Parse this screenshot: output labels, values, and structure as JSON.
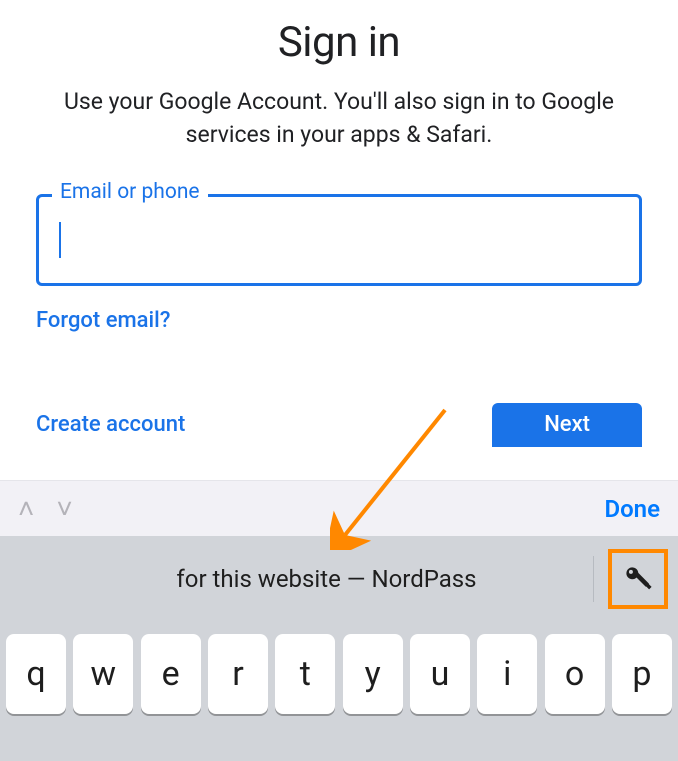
{
  "colors": {
    "primary_blue": "#1a73e8",
    "ios_blue": "#007aff",
    "highlight_orange": "#ff8800"
  },
  "header": {
    "title": "Sign in",
    "subtitle": "Use your Google Account. You'll also sign in to Google services in your apps & Safari."
  },
  "field": {
    "label": "Email or phone",
    "value": ""
  },
  "links": {
    "forgot": "Forgot email?",
    "create": "Create account"
  },
  "buttons": {
    "next": "Next"
  },
  "keyboard": {
    "done": "Done",
    "autofill_text": "for this website — NordPass",
    "row": [
      "q",
      "w",
      "e",
      "r",
      "t",
      "y",
      "u",
      "i",
      "o",
      "p"
    ]
  },
  "icons": {
    "chevron_up": "˄",
    "chevron_down": "˅"
  }
}
